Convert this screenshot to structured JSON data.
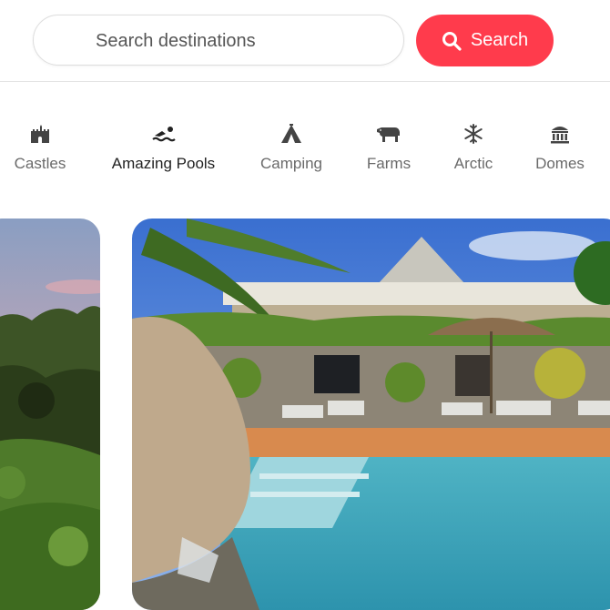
{
  "search": {
    "placeholder": "Search destinations",
    "button_label": "Search"
  },
  "categories": [
    {
      "label": "Castles",
      "icon": "castle-icon",
      "active": false
    },
    {
      "label": "Amazing Pools",
      "icon": "pool-icon",
      "active": true
    },
    {
      "label": "Camping",
      "icon": "tent-icon",
      "active": false
    },
    {
      "label": "Farms",
      "icon": "cow-icon",
      "active": false
    },
    {
      "label": "Arctic",
      "icon": "snowflake-icon",
      "active": false
    },
    {
      "label": "Domes",
      "icon": "dome-icon",
      "active": false
    }
  ],
  "listings": [
    {
      "image": "jungle-hillside-photo"
    },
    {
      "image": "villa-pool-photo"
    }
  ],
  "colors": {
    "accent": "#ff3b4c",
    "text": "#222222",
    "muted": "#6a6a6a",
    "divider": "#e4e4e4"
  }
}
